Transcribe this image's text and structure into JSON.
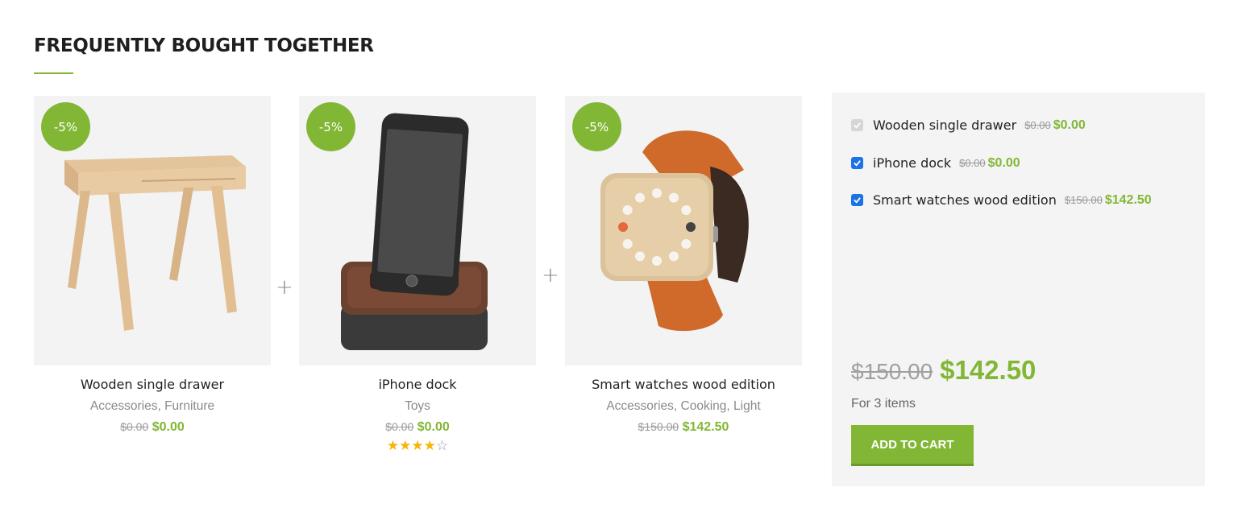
{
  "section": {
    "title": "FREQUENTLY BOUGHT TOGETHER"
  },
  "colors": {
    "accent": "#82b735",
    "badge_text": "#ffffff",
    "old_price": "#9a9a9a",
    "star": "#f5b50a"
  },
  "plus_symbol": "+",
  "products": [
    {
      "badge": "-5%",
      "name": "Wooden single drawer",
      "categories": [
        "Accessories",
        "Furniture"
      ],
      "cat_sep": ", ",
      "old_price": "$0.00",
      "price": "$0.00",
      "image_icon": "wooden-drawer-image"
    },
    {
      "badge": "-5%",
      "name": "iPhone dock",
      "categories": [
        "Toys"
      ],
      "old_price": "$0.00",
      "price": "$0.00",
      "rating": 4,
      "rating_max": 5,
      "image_icon": "iphone-dock-image"
    },
    {
      "badge": "-5%",
      "name": "Smart watches wood edition",
      "categories": [
        "Accessories",
        "Cooking",
        "Light"
      ],
      "cat_sep": ", ",
      "old_price": "$150.00",
      "price": "$142.50",
      "image_icon": "wood-watch-image"
    }
  ],
  "bundle": {
    "items": [
      {
        "name": "Wooden single drawer",
        "old_price": "$0.00",
        "price": "$0.00",
        "checked": true,
        "disabled": true
      },
      {
        "name": "iPhone dock",
        "old_price": "$0.00",
        "price": "$0.00",
        "checked": true,
        "disabled": false
      },
      {
        "name": "Smart watches wood edition",
        "old_price": "$150.00",
        "price": "$142.50",
        "checked": true,
        "disabled": false
      }
    ],
    "total_old": "$150.00",
    "total_new": "$142.50",
    "count_text": "For 3 items",
    "button_label": "ADD TO CART"
  }
}
